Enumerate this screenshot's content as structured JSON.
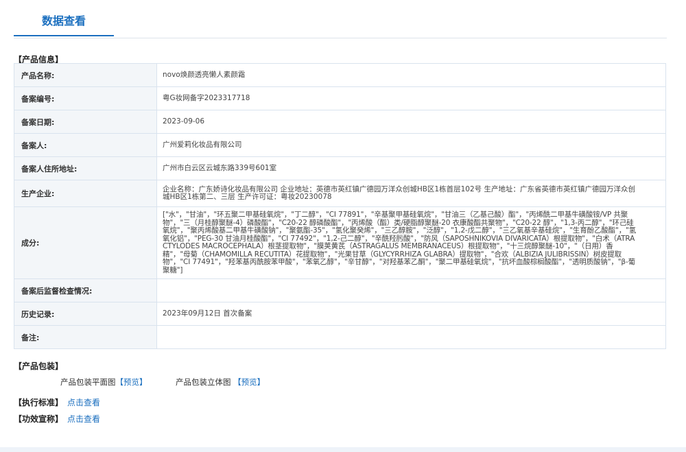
{
  "tab": {
    "title": "数据查看"
  },
  "product_info": {
    "section_title": "【产品信息】",
    "rows": [
      {
        "label": "产品名称:",
        "value": "novo焕颜透亮懒人素颜霜"
      },
      {
        "label": "备案编号:",
        "value": "粤G妆网备字2023317718"
      },
      {
        "label": "备案日期:",
        "value": "2023-09-06"
      },
      {
        "label": "备案人:",
        "value": "广州爱莉化妆品有限公司"
      },
      {
        "label": "备案人住所地址:",
        "value": "广州市白云区云城东路339号601室"
      },
      {
        "label": "生产企业:",
        "value": "企业名称：广东娇诗化妆品有限公司 企业地址：英德市英红镇广德园万洋众创城HB区1栋首层102号 生产地址：广东省英德市英红镇广德园万洋众创城HB区1栋第二、三层 生产许可证：粤妆20230078"
      },
      {
        "label": "成分:",
        "value": "[\"水\"，\"甘油\"，\"环五聚二甲基硅氧烷\"，\"丁二醇\"，\"CI 77891\"，\"辛基聚甲基硅氧烷\"，\"甘油三（乙基己酸）酯\"，\"丙烯酰二甲基牛磺酸铵/VP 共聚物\"，\"三（月桂醇聚醚-4）磷酸酯\"，\"C20-22 醇磷酸酯\"，\"丙烯酸（酯）类/硬脂醇聚醚-20 衣康酸酯共聚物\"，\"C20-22 醇\"，\"1,3-丙二醇\"，\"环己硅氧烷\"，\"聚丙烯酸基二甲基牛磺酸钠\"，\"聚氨酯-35\"，\"氢化聚癸烯\"，\"三乙醇胺\"，\"泛醇\"，\"1,2-戊二醇\"，\"三乙氧基辛基硅烷\"，\"生育酚乙酸酯\"，\"氢氧化铝\"，\"PEG-30 甘油月桂酸酯\"，\"CI 77492\"，\"1,2-己二醇\"，\"辛酰羟肟酸\"，\"防风（SAPOSHNIKOVIA DIVARICATA）根提取物\"，\"白术（ATRACTYLODES MACROCEPHALA）根茎提取物\"，\"膜荚黄芪（ASTRAGALUS MEMBRANACEUS）根提取物\"，\"十三烷醇聚醚-10\"，\"（日用）香精\"，\"母菊（CHAMOMILLA RECUTITA）花提取物\"，\"光果甘草（GLYCYRRHIZA GLABRA）提取物\"，\"合欢（ALBIZIA JULIBRISSIN）树皮提取物\"，\"CI 77491\"，\"羟苯基丙酰胺苯甲酸\"，\"苯氧乙醇\"，\"辛甘醇\"，\"对羟基苯乙酮\"，\"聚二甲基硅氧烷\"，\"抗坏血酸棕榈酸酯\"，\"透明质酸钠\"，\"β-葡聚糖\"]"
      },
      {
        "label": "备案后监督检查情况:",
        "value": ""
      },
      {
        "label": "历史记录:",
        "value": "2023年09月12日 首次备案"
      },
      {
        "label": "备注:",
        "value": ""
      }
    ]
  },
  "packaging": {
    "section_title": "【产品包装】",
    "flat_label": "产品包装平面图",
    "flat_link": "【预览】",
    "solid_label": "产品包装立体图",
    "solid_link": "【预览】"
  },
  "standard": {
    "label": "【执行标准】",
    "link": "点击查看"
  },
  "efficacy": {
    "label": "【功效宣称】",
    "link": "点击查看"
  },
  "colors": {
    "accent": "#1b6fbf",
    "label_bg": "#f3f6f9",
    "border": "#c6d7ea"
  }
}
